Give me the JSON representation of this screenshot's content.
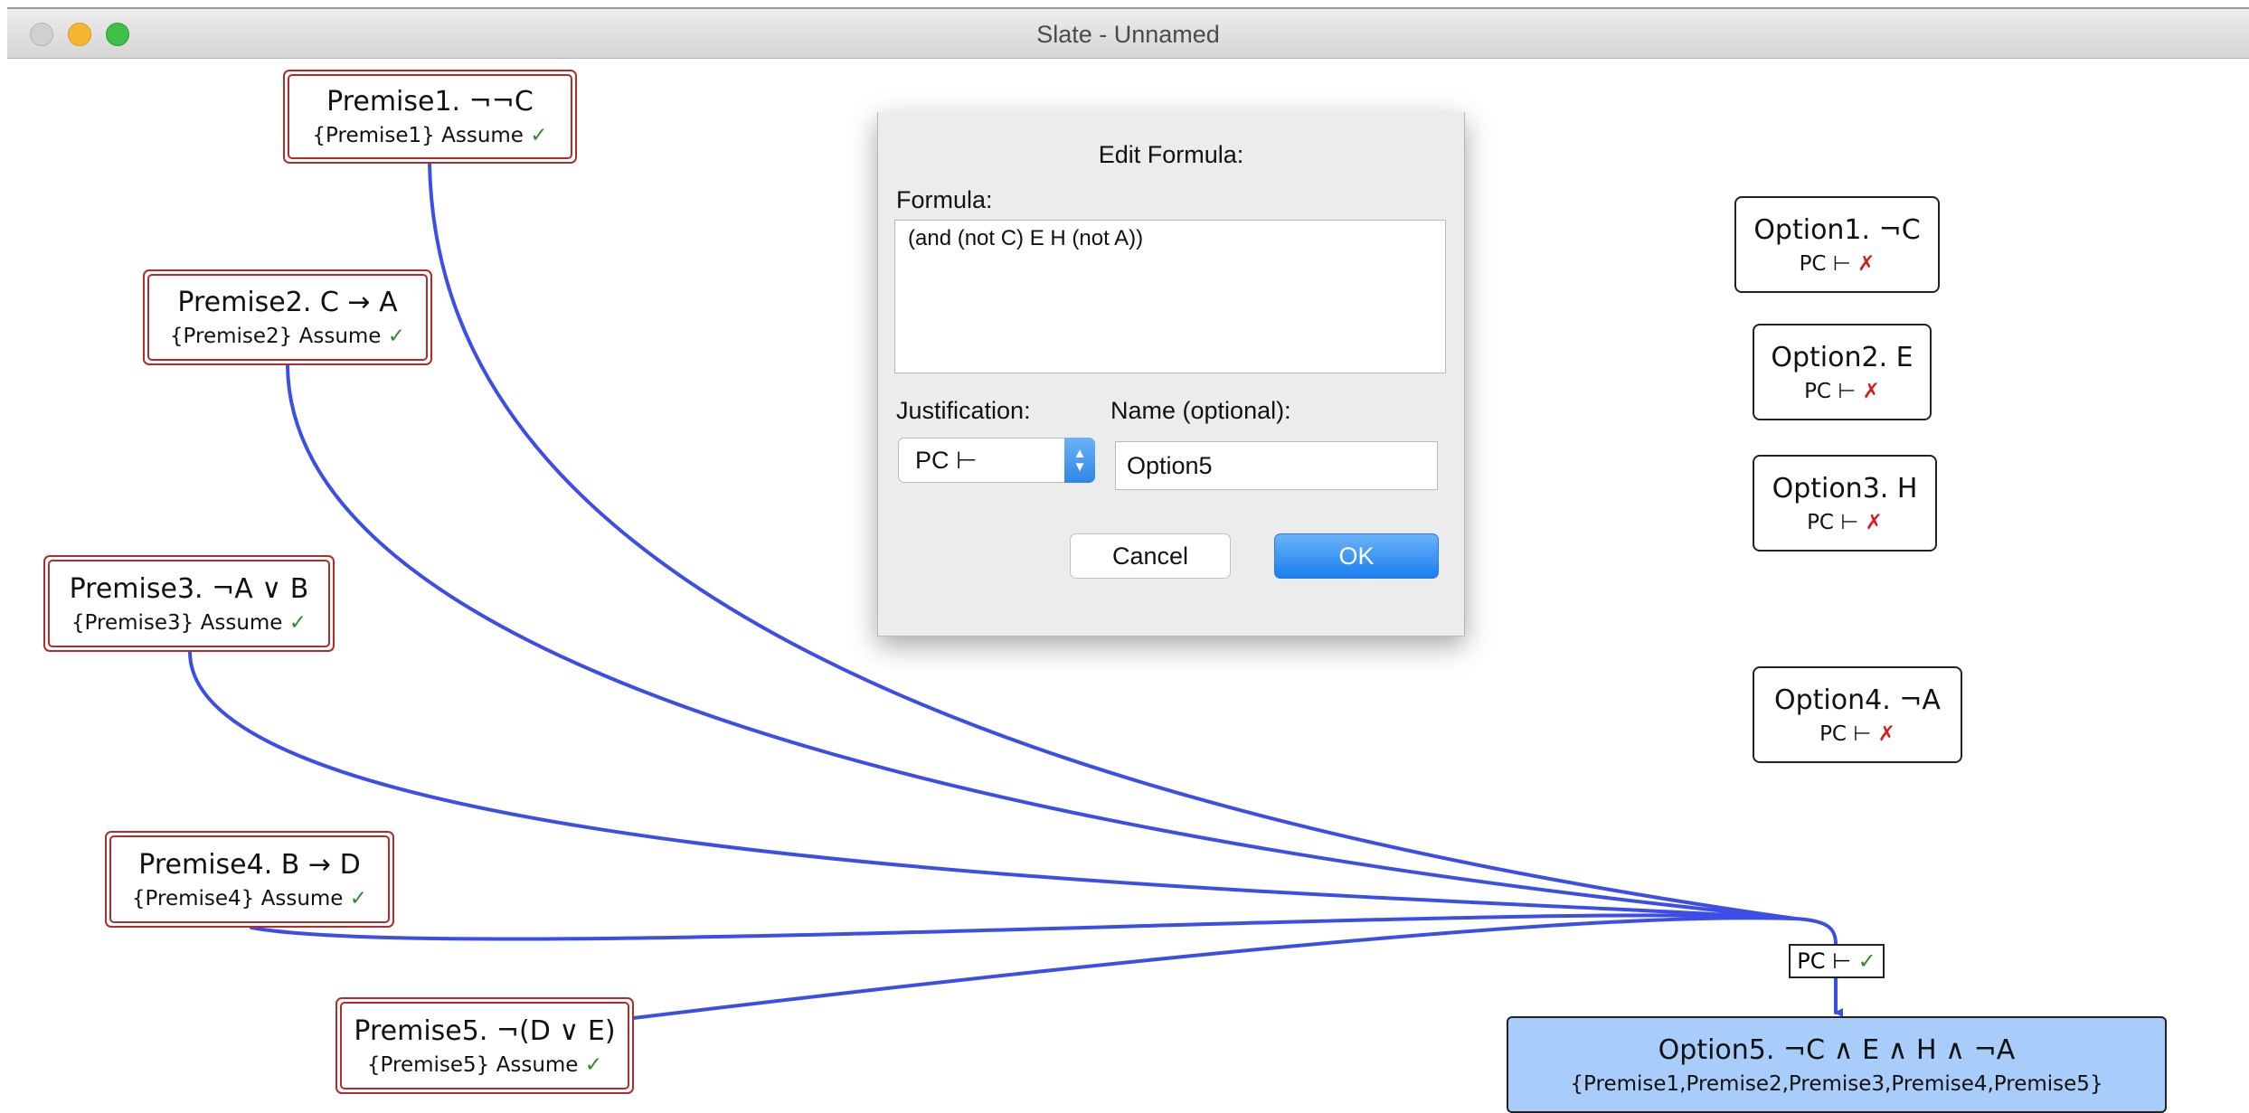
{
  "window": {
    "title": "Slate - Unnamed"
  },
  "premises": [
    {
      "id": "premise1",
      "title": "Premise1. ¬¬C",
      "support": "{Premise1} Assume",
      "status": "✓"
    },
    {
      "id": "premise2",
      "title": "Premise2. C → A",
      "support": "{Premise2} Assume",
      "status": "✓"
    },
    {
      "id": "premise3",
      "title": "Premise3. ¬A ∨ B",
      "support": "{Premise3} Assume",
      "status": "✓"
    },
    {
      "id": "premise4",
      "title": "Premise4. B → D",
      "support": "{Premise4} Assume",
      "status": "✓"
    },
    {
      "id": "premise5",
      "title": "Premise5. ¬(D ∨ E)",
      "support": "{Premise5} Assume",
      "status": "✓"
    }
  ],
  "options": [
    {
      "id": "option1",
      "title": "Option1. ¬C",
      "justification": "PC ⊢",
      "status": "✗"
    },
    {
      "id": "option2",
      "title": "Option2. E",
      "justification": "PC ⊢",
      "status": "✗"
    },
    {
      "id": "option3",
      "title": "Option3. H",
      "justification": "PC ⊢",
      "status": "✗"
    },
    {
      "id": "option4",
      "title": "Option4. ¬A",
      "justification": "PC ⊢",
      "status": "✗"
    }
  ],
  "conclusion": {
    "title": "Option5. ¬C ∧ E ∧ H ∧ ¬A",
    "support": "{Premise1,Premise2,Premise3,Premise4,Premise5}",
    "justification": "PC ⊢",
    "status": "✓"
  },
  "dialog": {
    "title": "Edit Formula:",
    "formula_label": "Formula:",
    "formula_value": "(and (not C) E H (not A))",
    "justification_label": "Justification:",
    "justification_value": "PC ⊢",
    "name_label": "Name (optional):",
    "name_value": "Option5",
    "cancel_label": "Cancel",
    "ok_label": "OK"
  },
  "colors": {
    "edge": "#3d4ee8",
    "premise_border": "#b52a2a",
    "conclusion_fill": "#a9cdfb",
    "check": "#2d8a2d",
    "cross": "#d22020"
  }
}
